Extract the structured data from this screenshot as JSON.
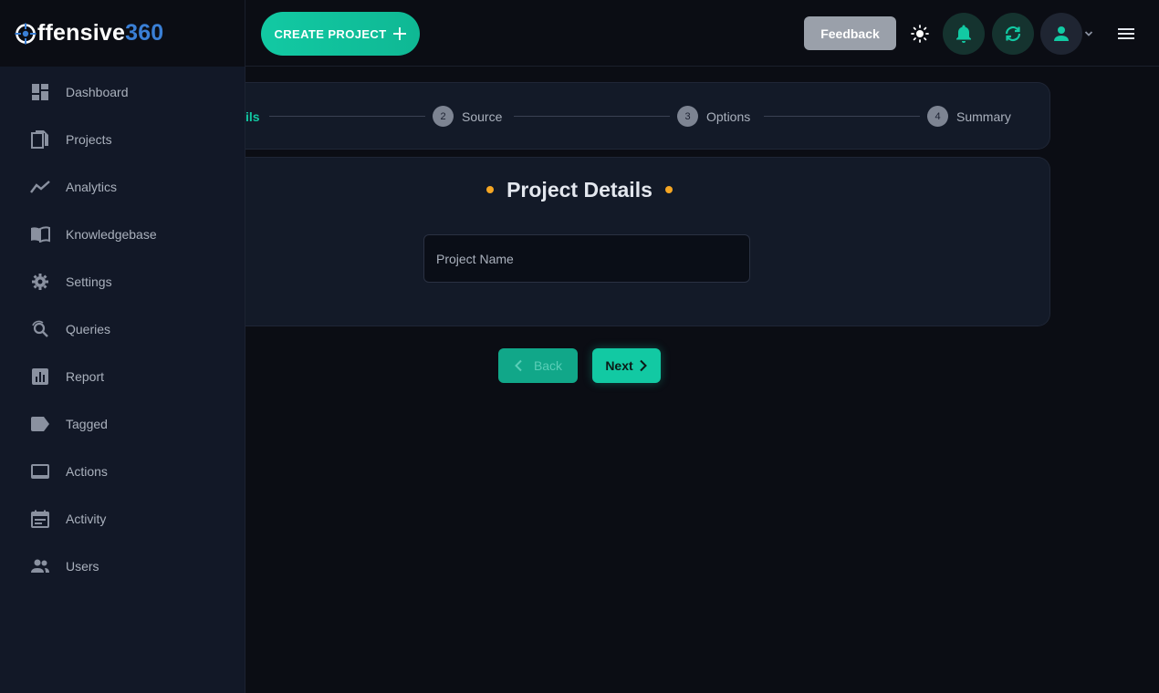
{
  "brand": {
    "logo_white": "ffensive",
    "logo_blue": "360"
  },
  "header": {
    "create_label": "CREATE PROJECT",
    "feedback_label": "Feedback"
  },
  "sidebar": {
    "items": [
      {
        "label": "Dashboard",
        "icon": "dashboard-icon"
      },
      {
        "label": "Projects",
        "icon": "projects-icon"
      },
      {
        "label": "Analytics",
        "icon": "analytics-icon"
      },
      {
        "label": "Knowledgebase",
        "icon": "book-icon"
      },
      {
        "label": "Settings",
        "icon": "gear-icon"
      },
      {
        "label": "Queries",
        "icon": "query-icon"
      },
      {
        "label": "Report",
        "icon": "report-icon"
      },
      {
        "label": "Tagged",
        "icon": "tag-icon"
      },
      {
        "label": "Actions",
        "icon": "actions-icon"
      },
      {
        "label": "Activity",
        "icon": "calendar-icon"
      },
      {
        "label": "Users",
        "icon": "users-icon"
      }
    ]
  },
  "stepper": {
    "active_label": "ils",
    "steps": [
      {
        "num": "2",
        "label": "Source"
      },
      {
        "num": "3",
        "label": "Options"
      },
      {
        "num": "4",
        "label": "Summary"
      }
    ]
  },
  "details": {
    "title": "Project Details",
    "name_placeholder": "Project Name"
  },
  "buttons": {
    "back": "Back",
    "next": "Next"
  },
  "colors": {
    "accent": "#12c9a3",
    "dot": "#f5a623",
    "brand_blue": "#3a7fd5"
  }
}
